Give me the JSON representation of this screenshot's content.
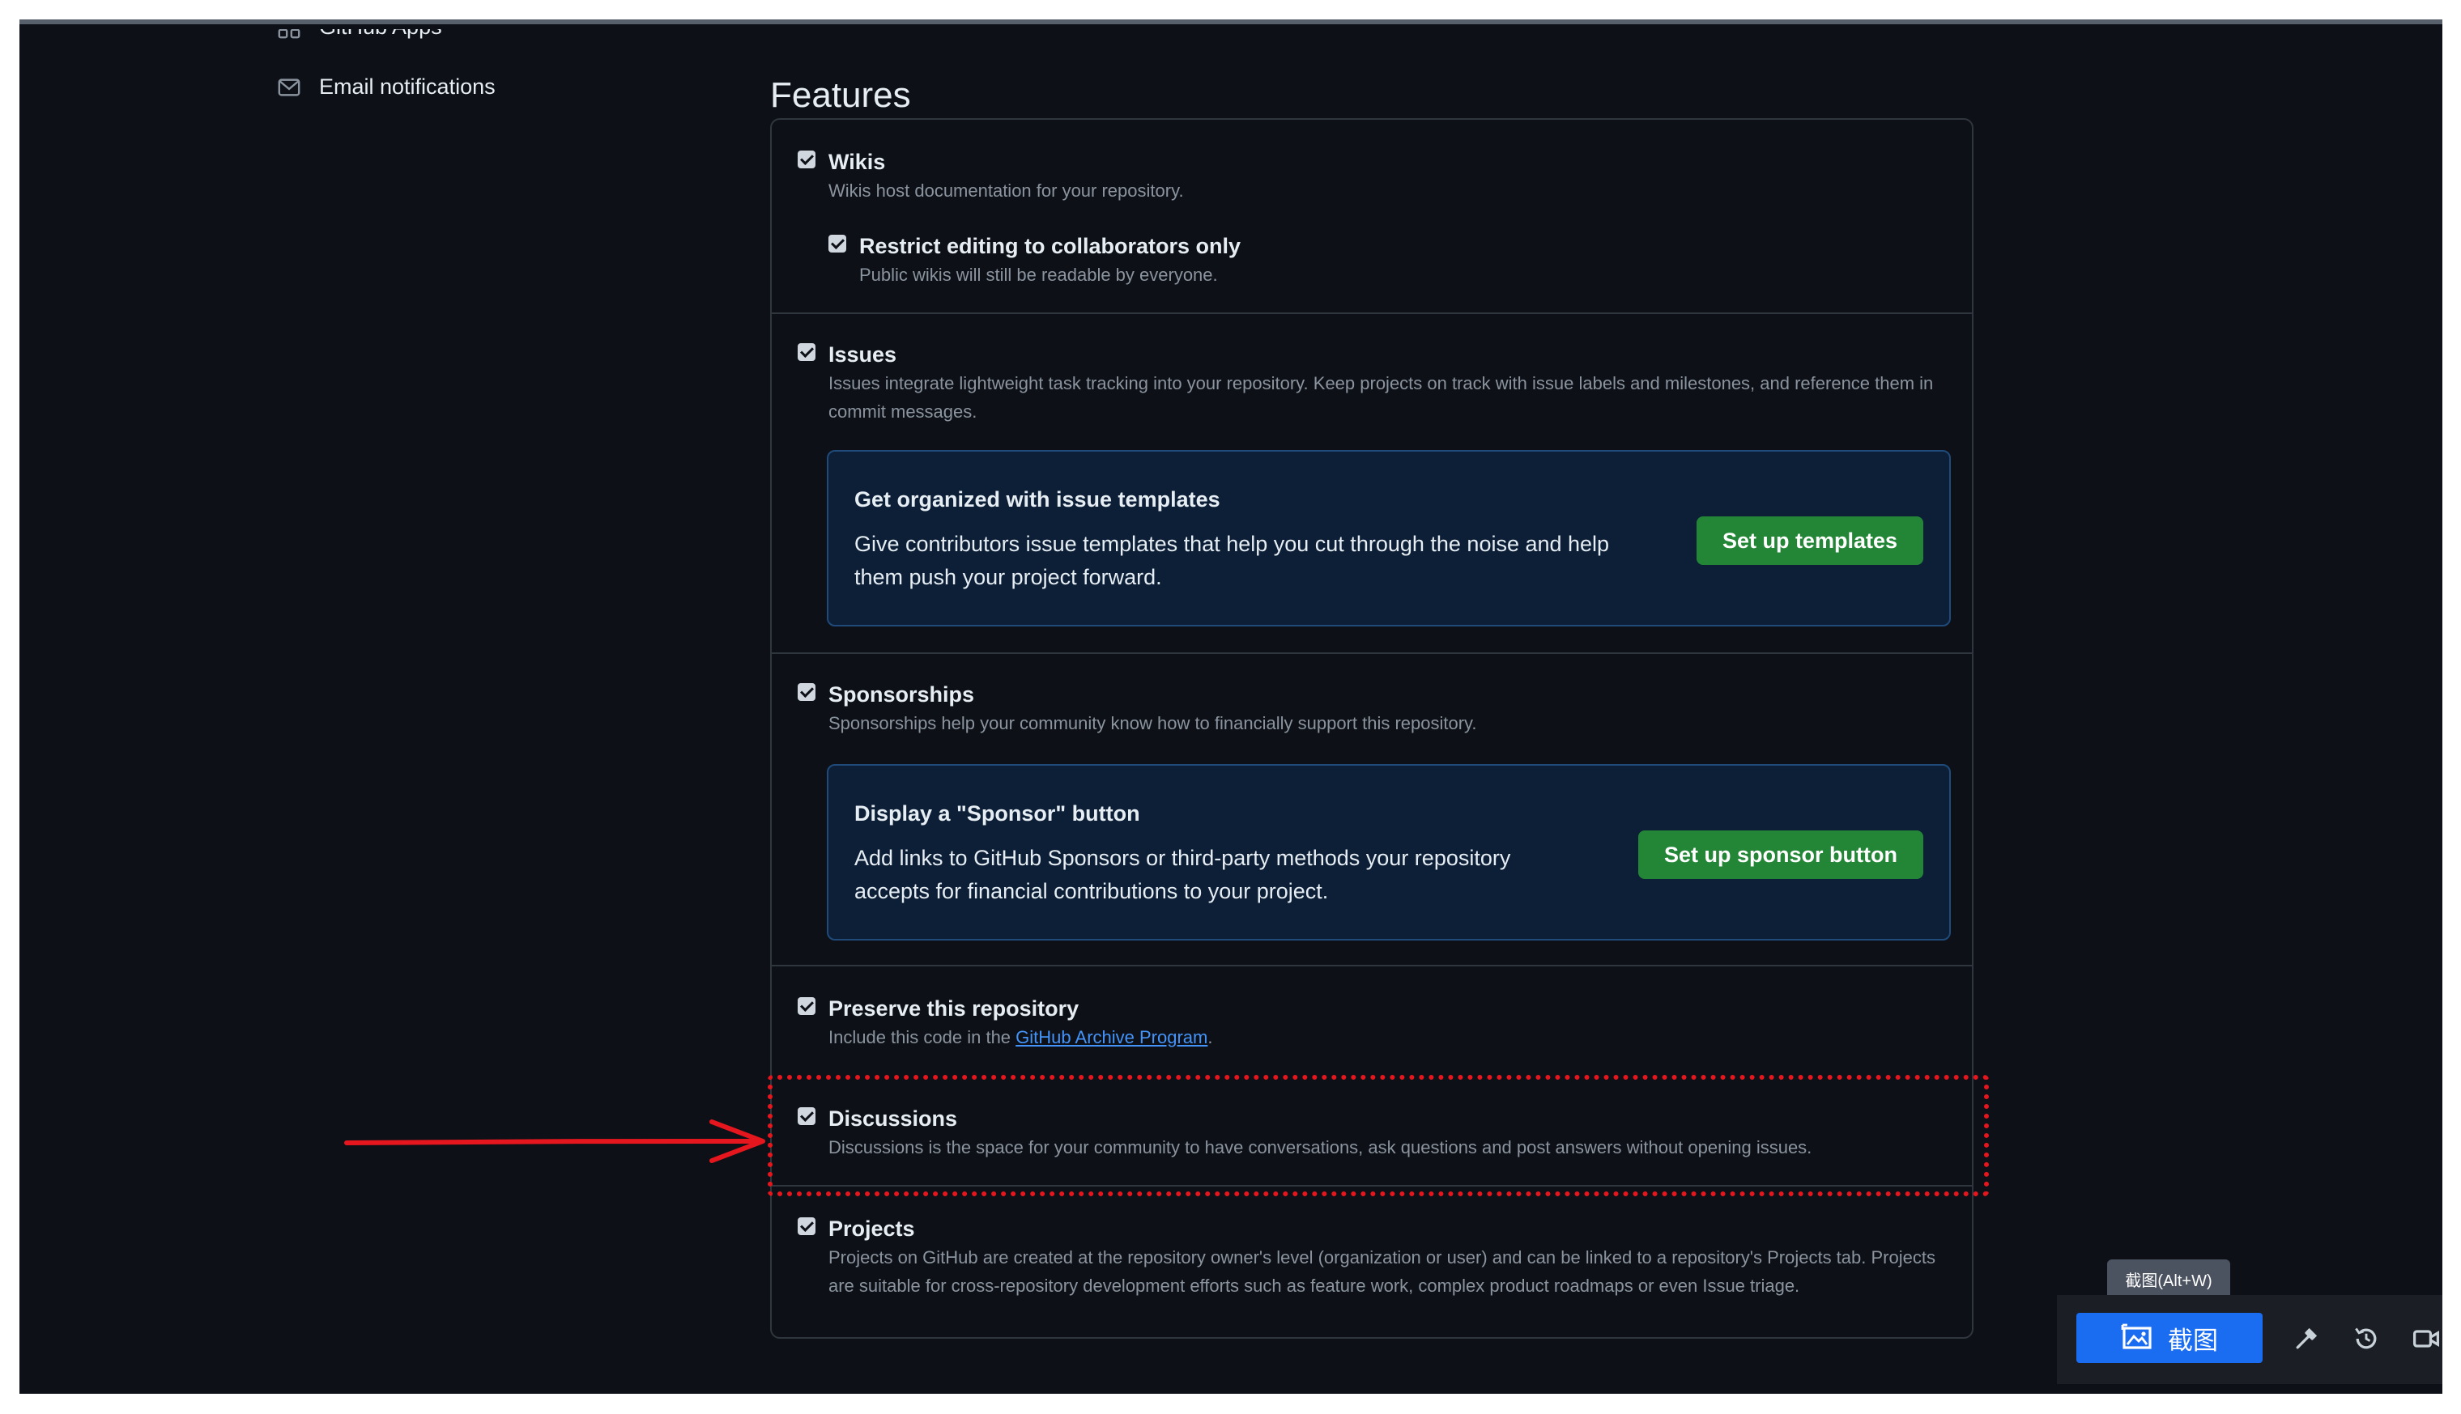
{
  "sidebar": {
    "apps_label": "GitHub Apps",
    "email_label": "Email notifications"
  },
  "features": {
    "title": "Features",
    "wikis": {
      "label": "Wikis",
      "desc": "Wikis host documentation for your repository.",
      "checked": true,
      "restrict": {
        "label": "Restrict editing to collaborators only",
        "desc": "Public wikis will still be readable by everyone.",
        "checked": true
      }
    },
    "issues": {
      "label": "Issues",
      "desc": "Issues integrate lightweight task tracking into your repository. Keep projects on track with issue labels and milestones, and reference them in commit messages.",
      "checked": true,
      "promo": {
        "title": "Get organized with issue templates",
        "body": "Give contributors issue templates that help you cut through the noise and help them push your project forward.",
        "button": "Set up templates"
      }
    },
    "sponsorships": {
      "label": "Sponsorships",
      "desc": "Sponsorships help your community know how to financially support this repository.",
      "checked": true,
      "promo": {
        "title": "Display a \"Sponsor\" button",
        "body": "Add links to GitHub Sponsors or third-party methods your repository accepts for financial contributions to your project.",
        "button": "Set up sponsor button"
      }
    },
    "preserve": {
      "label": "Preserve this repository",
      "desc_prefix": "Include this code in the ",
      "link": "GitHub Archive Program",
      "desc_suffix": ".",
      "checked": true
    },
    "discussions": {
      "label": "Discussions",
      "desc": "Discussions is the space for your community to have conversations, ask questions and post answers without opening issues.",
      "checked": true
    },
    "projects": {
      "label": "Projects",
      "desc": "Projects on GitHub are created at the repository owner's level (organization or user) and can be linked to a repository's Projects tab. Projects are suitable for cross-repository development efforts such as feature work, complex product roadmaps or even Issue triage.",
      "checked": true
    }
  },
  "capture_tool": {
    "tooltip": "截图(Alt+W)",
    "capture_label": "截图",
    "icons": [
      "image-icon",
      "eyedropper-icon",
      "history-icon",
      "video-icon"
    ]
  },
  "colors": {
    "background": "#0d1117",
    "border": "#30363d",
    "accent_green": "#238636",
    "link_blue": "#4493f8",
    "annotation_red": "#e5161d",
    "capture_blue": "#1a6cf1"
  }
}
